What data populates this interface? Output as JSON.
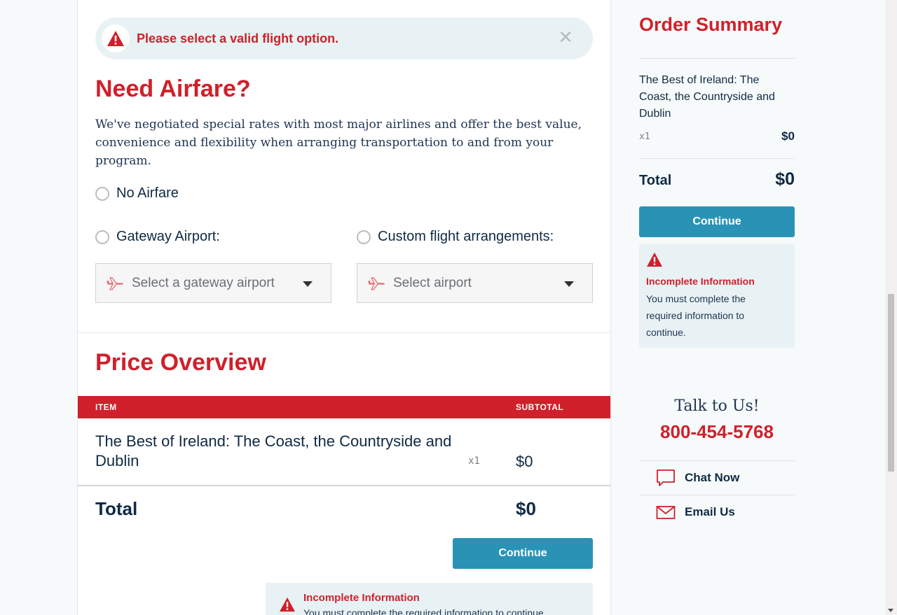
{
  "alert": {
    "message": "Please select a valid flight option.",
    "close_glyph": "✕"
  },
  "airfare": {
    "heading": "Need Airfare?",
    "intro": "We've negotiated special rates with most major airlines and offer the best value, convenience and flexibility when arranging transportation to and from your program.",
    "options": {
      "no_airfare": "No Airfare",
      "gateway": "Gateway Airport:",
      "custom": "Custom flight arrangements:"
    },
    "gateway_select": {
      "value": "Select a gateway airport",
      "icon": "airplane-icon"
    },
    "custom_select": {
      "value": "Select airport",
      "icon": "airplane-icon"
    }
  },
  "price": {
    "heading": "Price Overview",
    "columns": {
      "item": "ITEM",
      "subtotal": "SUBTOTAL"
    },
    "rows": [
      {
        "name": "The Best of Ireland: The Coast, the Countryside and Dublin",
        "qty": "x1",
        "subtotal": "$0"
      }
    ],
    "total_label": "Total",
    "total_value": "$0",
    "continue_label": "Continue",
    "incomplete": {
      "title": "Incomplete Information",
      "message": "You must complete the required information to continue."
    }
  },
  "summary": {
    "title": "Order Summary",
    "item_name": "The Best of Ireland: The Coast, the Countryside and Dublin",
    "qty": "x1",
    "price": "$0",
    "total_label": "Total",
    "total_value": "$0",
    "continue_label": "Continue",
    "incomplete": {
      "title": "Incomplete Information",
      "message": "You must complete the required information to continue."
    }
  },
  "contact": {
    "talk": "Talk to Us!",
    "phone": "800-454-5768",
    "chat": "Chat Now",
    "email": "Email Us"
  },
  "colors": {
    "brand_red": "#d0202b",
    "button_teal": "#2a93b5",
    "navy_text": "#0f2a44",
    "alert_bg": "#e8f2f4"
  }
}
